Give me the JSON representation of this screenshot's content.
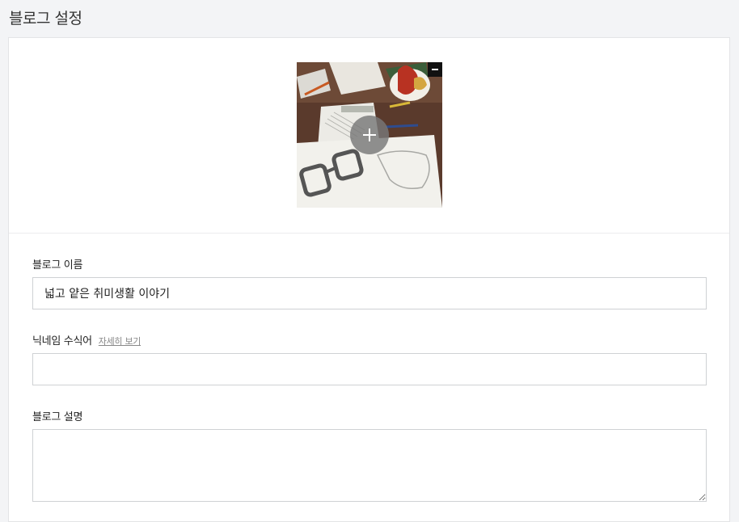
{
  "page": {
    "title": "블로그 설정"
  },
  "profile_image": {
    "alt": "blog image"
  },
  "fields": {
    "blog_name": {
      "label": "블로그 이름",
      "value": "넓고 얕은 취미생활 이야기"
    },
    "nickname_modifier": {
      "label": "닉네임 수식어",
      "help_link": "자세히 보기",
      "value": ""
    },
    "blog_description": {
      "label": "블로그 설명",
      "value": ""
    }
  },
  "icons": {
    "add": "plus-icon",
    "remove": "minus-icon"
  }
}
